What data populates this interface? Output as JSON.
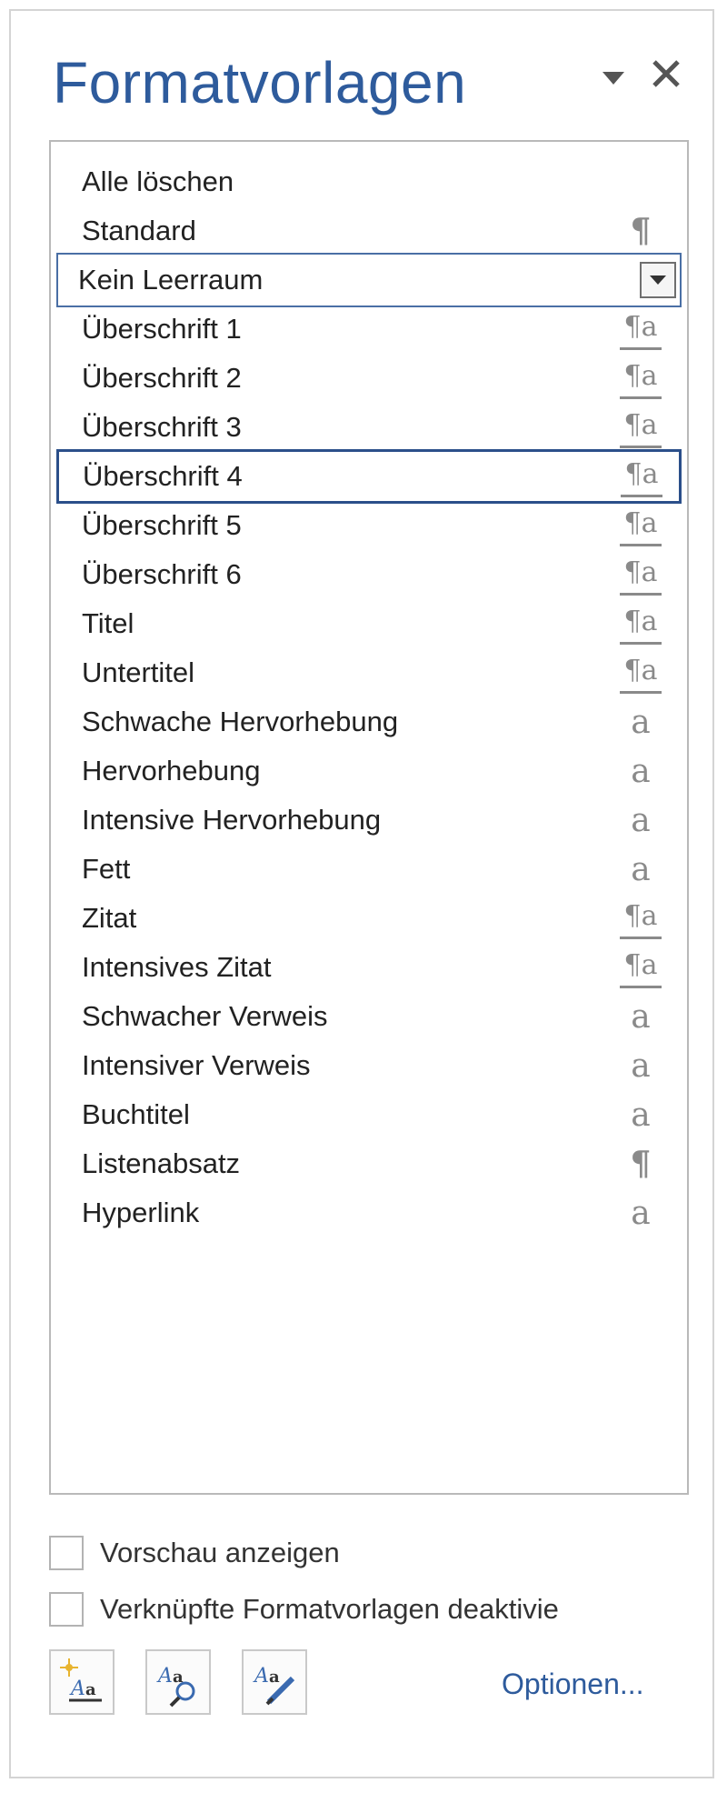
{
  "pane": {
    "title": "Formatvorlagen"
  },
  "styles": [
    {
      "label": "Alle löschen",
      "icon": "none"
    },
    {
      "label": "Standard",
      "icon": "paragraph-icon"
    },
    {
      "label": "Kein Leerraum",
      "icon": "dropdown-arrow-icon"
    },
    {
      "label": "Überschrift 1",
      "icon": "linked-style-icon"
    },
    {
      "label": "Überschrift 2",
      "icon": "linked-style-icon"
    },
    {
      "label": "Überschrift 3",
      "icon": "linked-style-icon"
    },
    {
      "label": "Überschrift 4",
      "icon": "linked-style-icon"
    },
    {
      "label": "Überschrift 5",
      "icon": "linked-style-icon"
    },
    {
      "label": "Überschrift 6",
      "icon": "linked-style-icon"
    },
    {
      "label": "Titel",
      "icon": "linked-style-icon"
    },
    {
      "label": "Untertitel",
      "icon": "linked-style-icon"
    },
    {
      "label": "Schwache Hervorhebung",
      "icon": "character-style-icon"
    },
    {
      "label": "Hervorhebung",
      "icon": "character-style-icon"
    },
    {
      "label": "Intensive Hervorhebung",
      "icon": "character-style-icon"
    },
    {
      "label": "Fett",
      "icon": "character-style-icon"
    },
    {
      "label": "Zitat",
      "icon": "linked-style-icon"
    },
    {
      "label": "Intensives Zitat",
      "icon": "linked-style-icon"
    },
    {
      "label": "Schwacher Verweis",
      "icon": "character-style-icon"
    },
    {
      "label": "Intensiver Verweis",
      "icon": "character-style-icon"
    },
    {
      "label": "Buchtitel",
      "icon": "character-style-icon"
    },
    {
      "label": "Listenabsatz",
      "icon": "paragraph-icon"
    },
    {
      "label": "Hyperlink",
      "icon": "character-style-icon"
    }
  ],
  "glyphs": {
    "paragraph": "¶",
    "linked": "¶a",
    "character": "a"
  },
  "checkboxes": {
    "preview": "Vorschau anzeigen",
    "disable_linked": "Verknüpfte Formatvorlagen deaktivie"
  },
  "footer": {
    "options_label": "Optionen..."
  },
  "colors": {
    "title": "#2e5b9c",
    "focus_border": "#2b4f8a",
    "icon_gray": "#8a8a8a"
  }
}
